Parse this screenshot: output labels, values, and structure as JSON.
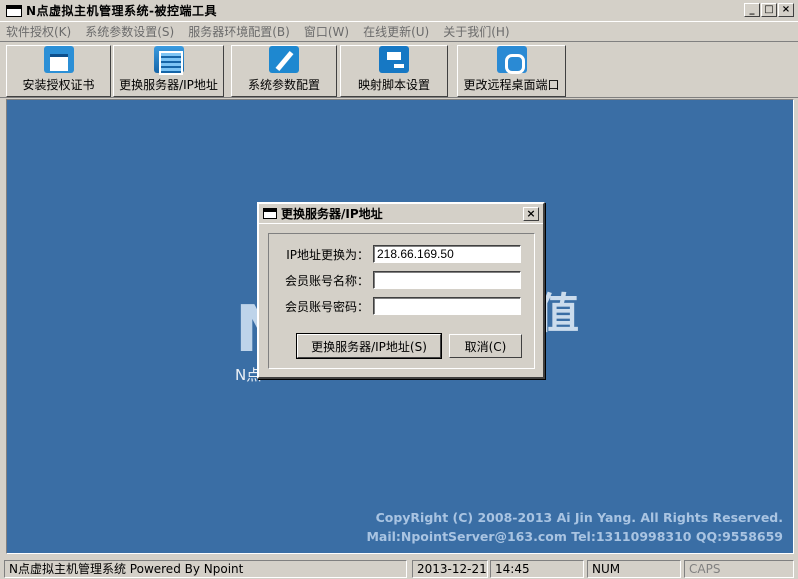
{
  "window": {
    "title": "N点虚拟主机管理系统-被控端工具",
    "minimize": "_",
    "maximize": "□",
    "close": "×"
  },
  "menu": [
    {
      "label": "软件授权(K)"
    },
    {
      "label": "系统参数设置(S)"
    },
    {
      "label": "服务器环境配置(B)"
    },
    {
      "label": "窗口(W)"
    },
    {
      "label": "在线更新(U)"
    },
    {
      "label": "关于我们(H)"
    }
  ],
  "toolbar": [
    {
      "label": "安装授权证书",
      "icon": "certificate-icon"
    },
    {
      "label": "更换服务器/IP地址",
      "icon": "server-icon"
    },
    {
      "label": "系统参数配置",
      "icon": "config-icon"
    },
    {
      "label": "映射脚本设置",
      "icon": "script-mapping-icon"
    },
    {
      "label": "更改远程桌面端口",
      "icon": "remote-desktop-icon"
    }
  ],
  "background": {
    "brand": "N",
    "brand_suffix": "值",
    "subtitle": "N点                              m",
    "copyright_line1": "CopyRight (C) 2008-2013 Ai Jin Yang. All Rights Reserved.",
    "copyright_line2": "Mail:NpointServer@163.com Tel:13110998310 QQ:9558659"
  },
  "dialog": {
    "title": "更换服务器/IP地址",
    "close": "×",
    "ip_label": "IP地址更换为：",
    "ip_value": "218.66.169.50",
    "account_label": "会员账号名称：",
    "account_value": "",
    "password_label": "会员账号密码：",
    "password_value": "",
    "confirm_button": "更换服务器/IP地址(S)",
    "cancel_button": "取消(C)"
  },
  "status": {
    "app": "N点虚拟主机管理系统 Powered By Npoint",
    "date": "2013-12-21",
    "time": "14:45",
    "num": "NUM",
    "caps": "CAPS"
  },
  "colors": {
    "desktop": "#3a6ea5",
    "chrome": "#d4d0c8"
  }
}
